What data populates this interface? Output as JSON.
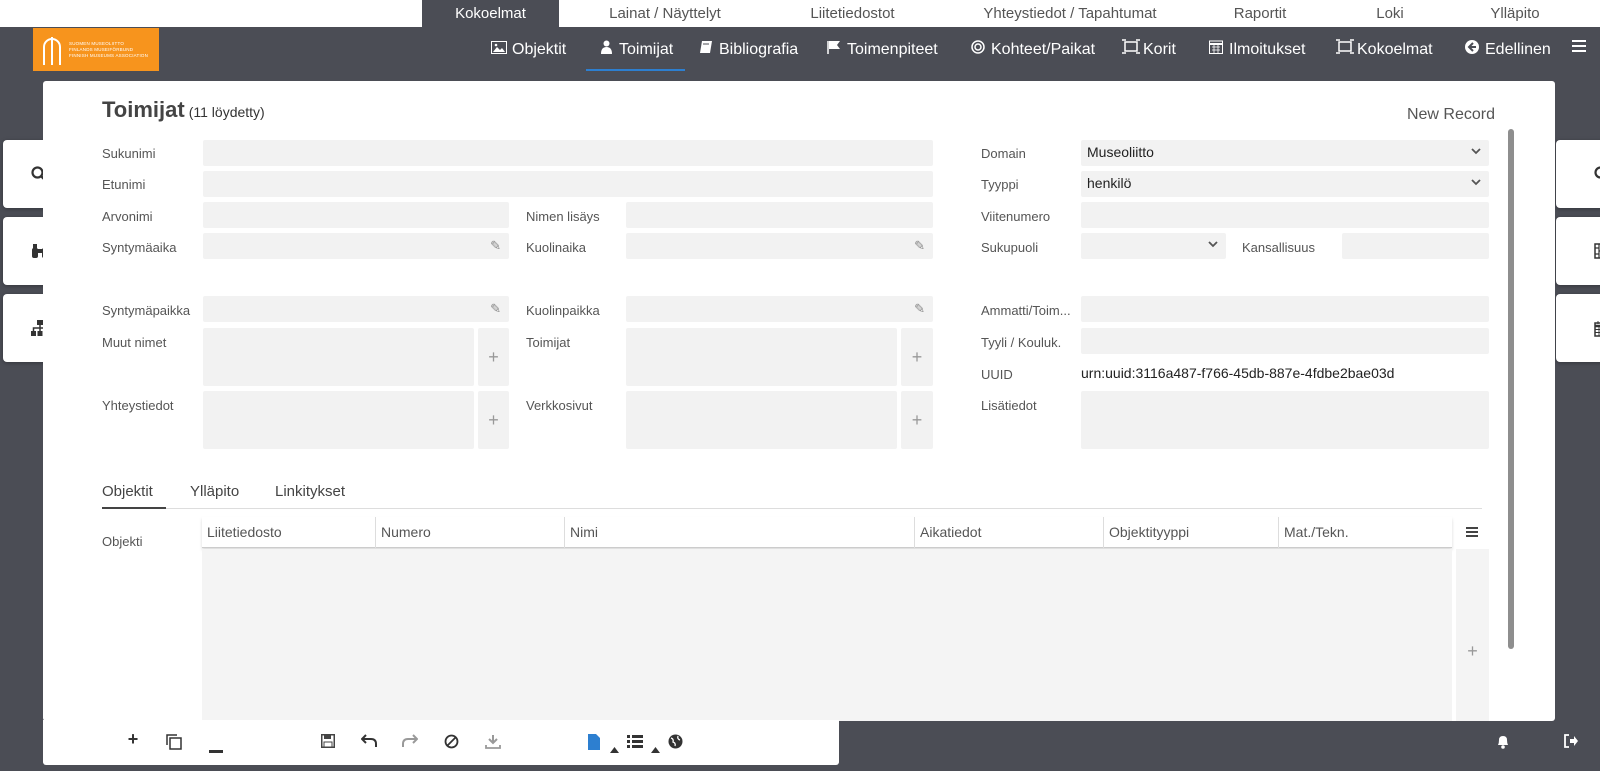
{
  "modules": [
    {
      "label": "Kokoelmat",
      "active": true
    },
    {
      "label": "Lainat / Näyttelyt",
      "active": false
    },
    {
      "label": "Liitetiedostot",
      "active": false
    },
    {
      "label": "Yhteystiedot / Tapahtumat",
      "active": false
    },
    {
      "label": "Raportit",
      "active": false
    },
    {
      "label": "Loki",
      "active": false
    },
    {
      "label": "Ylläpito",
      "active": false
    }
  ],
  "logo": {
    "line1": "SUOMEN MUSEOLIITTO",
    "line2": "FINLANDS MUSEIFÖRBUND",
    "line3": "FINNISH MUSEUMS ASSOCIATION",
    "color": "#f7941d"
  },
  "nav": [
    {
      "label": "Objektit",
      "icon": "image-icon",
      "active": false
    },
    {
      "label": "Toimijat",
      "icon": "user-icon",
      "active": true
    },
    {
      "label": "Bibliografia",
      "icon": "book-icon",
      "active": false
    },
    {
      "label": "Toimenpiteet",
      "icon": "flag-icon",
      "active": false
    },
    {
      "label": "Kohteet/Paikat",
      "icon": "target-icon",
      "active": false
    },
    {
      "label": "Korit",
      "icon": "basket-icon",
      "active": false
    },
    {
      "label": "Ilmoitukset",
      "icon": "calendar-icon",
      "active": false
    },
    {
      "label": "Kokoelmat",
      "icon": "collection-icon",
      "active": false
    },
    {
      "label": "Edellinen",
      "icon": "back-arrow-icon",
      "active": false
    }
  ],
  "page": {
    "title": "Toimijat",
    "count": "(11 löydetty)",
    "new_record": "New Record"
  },
  "form": {
    "sukunimi": {
      "label": "Sukunimi",
      "value": ""
    },
    "etunimi": {
      "label": "Etunimi",
      "value": ""
    },
    "arvonimi": {
      "label": "Arvonimi",
      "value": ""
    },
    "nimen_lisays": {
      "label": "Nimen lisäys",
      "value": ""
    },
    "syntymaaika": {
      "label": "Syntymäaika",
      "value": ""
    },
    "kuolinaika": {
      "label": "Kuolinaika",
      "value": ""
    },
    "syntymapaikka": {
      "label": "Syntymäpaikka",
      "value": ""
    },
    "kuolinpaikka": {
      "label": "Kuolinpaikka",
      "value": ""
    },
    "muut_nimet": {
      "label": "Muut nimet"
    },
    "toimijat": {
      "label": "Toimijat"
    },
    "yhteystiedot": {
      "label": "Yhteystiedot"
    },
    "verkkosivut": {
      "label": "Verkkosivut"
    },
    "domain": {
      "label": "Domain",
      "value": "Museoliitto"
    },
    "tyyppi": {
      "label": "Tyyppi",
      "value": "henkilö"
    },
    "viitenumero": {
      "label": "Viitenumero",
      "value": ""
    },
    "sukupuoli": {
      "label": "Sukupuoli",
      "value": ""
    },
    "kansallisuus": {
      "label": "Kansallisuus",
      "value": ""
    },
    "ammatti": {
      "label": "Ammatti/Toim...",
      "value": ""
    },
    "tyyli": {
      "label": "Tyyli / Kouluk.",
      "value": ""
    },
    "uuid": {
      "label": "UUID",
      "value": "urn:uuid:3116a487-f766-45db-887e-4fdbe2bae03d"
    },
    "lisatiedot": {
      "label": "Lisätiedot"
    }
  },
  "tabs": [
    {
      "label": "Objektit",
      "active": true
    },
    {
      "label": "Ylläpito",
      "active": false
    },
    {
      "label": "Linkitykset",
      "active": false
    }
  ],
  "grid": {
    "label": "Objekti",
    "columns": [
      "Liitetiedosto",
      "Numero",
      "Nimi",
      "Aikatiedot",
      "Objektityyppi",
      "Mat./Tekn."
    ],
    "rows": []
  },
  "colors": {
    "accent": "#2d7fd0",
    "background": "#4b4d55"
  }
}
